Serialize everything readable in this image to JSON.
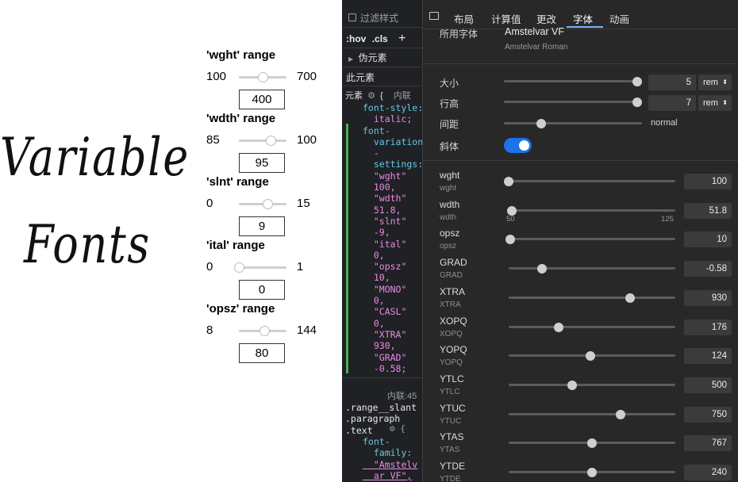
{
  "demo": {
    "headline_line1": "Variable",
    "headline_line2": "Fonts",
    "controls": [
      {
        "title": "'wght' range",
        "min": "100",
        "max": "700",
        "value": "400",
        "fraction": 0.5
      },
      {
        "title": "'wdth' range",
        "min": "85",
        "max": "100",
        "value": "95",
        "fraction": 0.67
      },
      {
        "title": "'slnt' range",
        "min": "0",
        "max": "15",
        "value": "9",
        "fraction": 0.6
      },
      {
        "title": "'ital' range",
        "min": "0",
        "max": "1",
        "value": "0",
        "fraction": 0.0
      },
      {
        "title": "'opsz' range",
        "min": "8",
        "max": "144",
        "value": "80",
        "fraction": 0.53
      }
    ]
  },
  "styles": {
    "filter_label": "过滤样式",
    "hov_label": ":hov",
    "cls_label": ".cls",
    "add_label": "+",
    "pseudo_label": "伪元素",
    "this_element_label": "此元素",
    "element_label": "元素",
    "brace": "{",
    "inline_label": "内联",
    "code_lines": [
      "font-style:",
      "  italic;",
      "font-",
      "  variation",
      "  -",
      "  settings:",
      "  \"wght\"",
      "  100,",
      "  \"wdth\"",
      "  51.8,",
      "  \"slnt\"",
      "  -9,",
      "  \"ital\"",
      "  0,",
      "  \"opsz\"",
      "  10,",
      "  \"MONO\"",
      "  0,",
      "  \"CASL\"",
      "  0,",
      "  \"XTRA\"",
      "  930,",
      "  \"GRAD\"",
      "  -0.58;"
    ],
    "inline_source": "内联:45",
    "selector_lines": [
      ".range__slant",
      ".paragraph",
      ".text"
    ],
    "rule2_lines": [
      "font-",
      "  family:",
      "  \"Amstelv",
      "  ar VF\","
    ]
  },
  "font_panel": {
    "tabs": [
      "布局",
      "计算值",
      "更改",
      "字体",
      "动画"
    ],
    "active_tab": "字体",
    "used_font_label": "所用字体",
    "font_name": "Amstelvar VF",
    "font_style_name": "Amstelvar Roman",
    "size": {
      "label": "大小",
      "value": "5",
      "unit": "rem",
      "fraction": 1.0
    },
    "line_height": {
      "label": "行高",
      "value": "7",
      "unit": "rem",
      "fraction": 1.0
    },
    "spacing": {
      "label": "间距",
      "value": "normal",
      "fraction": 0.27
    },
    "italic": {
      "label": "斜体",
      "on": true
    },
    "axes": [
      {
        "tag": "wght",
        "sub": "wght",
        "value": "100",
        "fraction": 0.0
      },
      {
        "tag": "wdth",
        "sub": "wdth",
        "value": "51.8",
        "fraction": 0.02,
        "min_label": "50",
        "max_label": "125"
      },
      {
        "tag": "opsz",
        "sub": "opsz",
        "value": "10",
        "fraction": 0.01
      },
      {
        "tag": "GRAD",
        "sub": "GRAD",
        "value": "-0.58",
        "fraction": 0.2
      },
      {
        "tag": "XTRA",
        "sub": "XTRA",
        "value": "930",
        "fraction": 0.73
      },
      {
        "tag": "XOPQ",
        "sub": "XOPQ",
        "value": "176",
        "fraction": 0.3
      },
      {
        "tag": "YOPQ",
        "sub": "YOPQ",
        "value": "124",
        "fraction": 0.49
      },
      {
        "tag": "YTLC",
        "sub": "YTLC",
        "value": "500",
        "fraction": 0.38
      },
      {
        "tag": "YTUC",
        "sub": "YTUC",
        "value": "750",
        "fraction": 0.67
      },
      {
        "tag": "YTAS",
        "sub": "YTAS",
        "value": "767",
        "fraction": 0.5
      },
      {
        "tag": "YTDE",
        "sub": "YTDE",
        "value": "240",
        "fraction": 0.5
      }
    ]
  }
}
